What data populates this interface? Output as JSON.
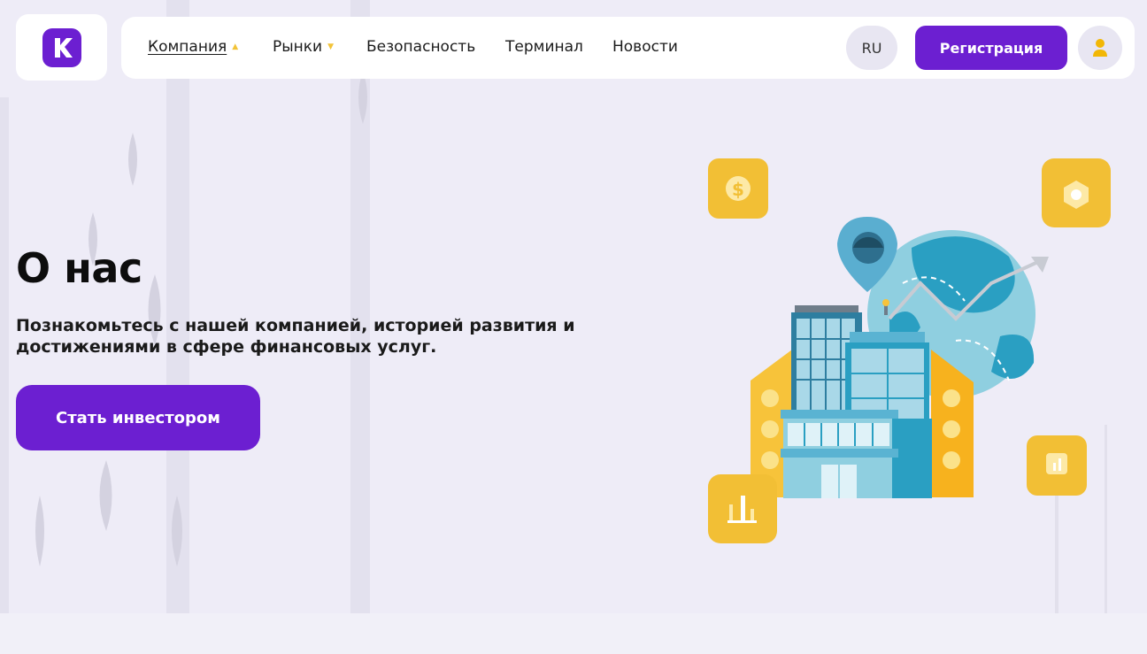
{
  "brand": {
    "logo_icon": "k-logo-icon",
    "accent": "#6c1fd1",
    "secondary": "#f2c338"
  },
  "nav": {
    "items": [
      {
        "label": "Компания",
        "dropdown": true,
        "active": true
      },
      {
        "label": "Рынки",
        "dropdown": true,
        "active": false
      },
      {
        "label": "Безопасность",
        "dropdown": false,
        "active": false
      },
      {
        "label": "Терминал",
        "dropdown": false,
        "active": false
      },
      {
        "label": "Новости",
        "dropdown": false,
        "active": false
      }
    ],
    "lang": "RU",
    "register_label": "Регистрация",
    "user_icon": "user-icon"
  },
  "hero": {
    "title": "О нас",
    "subtitle": "Познакомьтесь с нашей компанией, историей развития и достижениями в сфере финансовых услуг.",
    "cta_label": "Стать инвестором"
  },
  "illustration": {
    "icons": [
      "dollar-coin-icon",
      "hexagon-icon",
      "bar-chart-icon",
      "small-chart-icon",
      "location-pin-icon",
      "trend-arrow-icon",
      "office-building-icon",
      "globe-icon"
    ]
  }
}
